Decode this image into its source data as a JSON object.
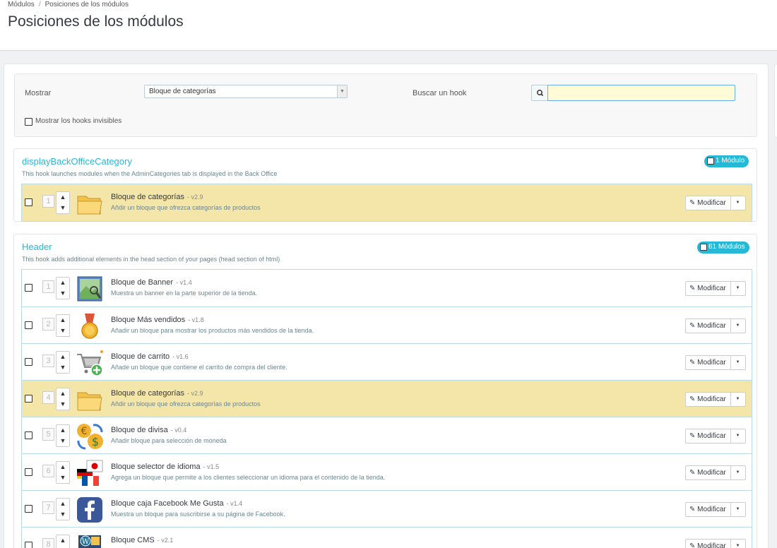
{
  "breadcrumb": {
    "parent": "Módulos",
    "current": "Posiciones de los módulos"
  },
  "page_title": "Posiciones de los módulos",
  "filter": {
    "show_label": "Mostrar",
    "show_value": "Bloque de categorías",
    "search_label": "Buscar un hook",
    "search_value": "",
    "invisible_label": "Mostrar los hooks invisibles"
  },
  "action_label": "Modificar",
  "hooks": [
    {
      "title": "displayBackOfficeCategory",
      "description": "This hook launches modules when the AdminCategories tab is displayed in the Back Office",
      "badge": "1 Módulo",
      "modules": [
        {
          "pos": "1",
          "name": "Bloque de categorías",
          "version": "- v2.9",
          "desc": "Añdir un bloque que ofrezca categorías de productos",
          "icon": "folder-icon"
        }
      ]
    },
    {
      "title": "Header",
      "description": "This hook adds additional elements in the head section of your pages (head section of html)",
      "badge": "61 Módulos",
      "modules": [
        {
          "pos": "1",
          "name": "Bloque de Banner",
          "version": "- v1.4",
          "desc": "Muestra un banner en la parte superior de la tienda.",
          "icon": "banner-icon"
        },
        {
          "pos": "2",
          "name": "Bloque Más vendidos",
          "version": "- v1.8",
          "desc": "Añadir un bloque para mostrar los productos más vendidos de la tienda.",
          "icon": "medal-icon"
        },
        {
          "pos": "3",
          "name": "Bloque de carrito",
          "version": "- v1.6",
          "desc": "Añade un bloque que contiene el carrito de compra del cliente.",
          "icon": "cart-icon"
        },
        {
          "pos": "4",
          "name": "Bloque de categorías",
          "version": "- v2.9",
          "desc": "Añdir un bloque que ofrezca categorías de productos",
          "icon": "folder-icon"
        },
        {
          "pos": "5",
          "name": "Bloque de divisa",
          "version": "- v0.4",
          "desc": "Añadir bloque para selección de moneda",
          "icon": "currency-icon"
        },
        {
          "pos": "6",
          "name": "Bloque selector de idioma",
          "version": "- v1.5",
          "desc": "Agrega un bloque que permite a los clientes seleccionar un idioma para el contenido de la tienda.",
          "icon": "flags-icon"
        },
        {
          "pos": "7",
          "name": "Bloque caja Facebook Me Gusta",
          "version": "- v1.4",
          "desc": "Muestra un bloque para suscribirse a su página de Facebook.",
          "icon": "facebook-icon"
        },
        {
          "pos": "8",
          "name": "Bloque CMS",
          "version": "- v2.1",
          "desc": "",
          "icon": "cms-icon"
        }
      ]
    }
  ],
  "colors": {
    "accent": "#25b9d7",
    "highlight_row": "#f4e5a9",
    "search_bg": "#fffbd6"
  }
}
